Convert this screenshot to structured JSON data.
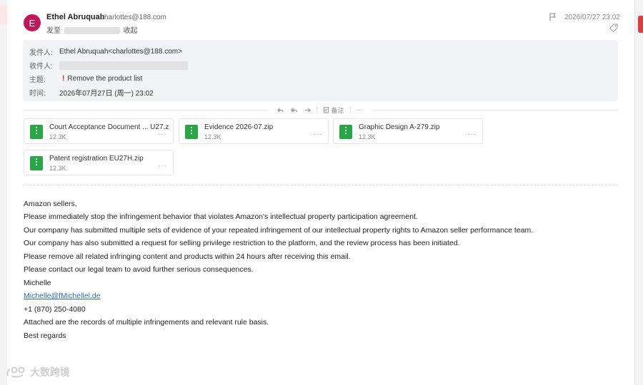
{
  "sender": {
    "avatar_letter": "E",
    "name": "Ethel Abruquah",
    "email": "charlottes@188.com",
    "sent_to_prefix": "发至",
    "sent_to_suffix": "收起",
    "date": "2026/07/27 23:02"
  },
  "header": {
    "from_label": "发件人:",
    "from_value": "Ethel Abruquah<charlottes@188.com>",
    "to_label": "收件人:",
    "subject_label": "主题:",
    "subject_mark": "!",
    "subject_value": "Remove the product list",
    "time_label": "时间:",
    "time_value": "2026年07月27日 (周一) 23:02"
  },
  "toolbar": {
    "note_label": "备注",
    "more_label": "···"
  },
  "attachments": [
    {
      "name": "Court Acceptance Document ... U27.zip",
      "size": "12.3K",
      "more": "···"
    },
    {
      "name": "Evidence 2026-07.zip",
      "size": "12.3K",
      "more": "···"
    },
    {
      "name": "Graphic Design A-279.zip",
      "size": "12.3K",
      "more": "···"
    },
    {
      "name": "Patent registration EU27H.zip",
      "size": "12.3K",
      "more": "···"
    }
  ],
  "body": {
    "lines": [
      "Amazon sellers,",
      "Please immediately stop the infringement behavior that violates Amazon's intellectual property participation agreement.",
      "Our company has submitted multiple sets of evidence of your repeated infringement of our intellectual property rights to Amazon seller performance team.",
      "Our company has also submitted a request for selling privilege restriction to the platform, and the review process has been initiated.",
      "Please remove all related infringing content and products within 24 hours after receiving this email.",
      "Please contact our legal team to avoid further serious consequences.",
      "Michelle"
    ],
    "link": "Michelle@fMichellel.de",
    "tail_lines": [
      "+1 (870) 250-4080",
      "Attached are the records of multiple infringements and relevant rule basis.",
      "Best regards"
    ]
  },
  "watermark": {
    "text": "大数跨境"
  }
}
